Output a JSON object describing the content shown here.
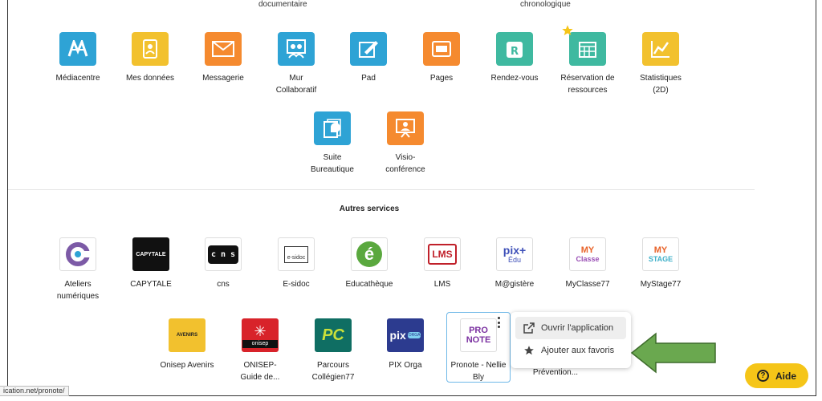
{
  "top_fragments": [
    "documentaire",
    "chronologique"
  ],
  "apps_row1": [
    {
      "label": "Médiacentre",
      "color": "#2ea3d5",
      "icon": "mediacentre-icon"
    },
    {
      "label": "Mes données",
      "color": "#f2c12e",
      "icon": "my-data-icon"
    },
    {
      "label": "Messagerie",
      "color": "#f58a2f",
      "icon": "envelope-icon"
    },
    {
      "label": "Mur Collaboratif",
      "color": "#2ea3d5",
      "icon": "collaborative-wall-icon"
    },
    {
      "label": "Pad",
      "color": "#2ea3d5",
      "icon": "pad-icon"
    },
    {
      "label": "Pages",
      "color": "#f58a2f",
      "icon": "pages-icon"
    },
    {
      "label": "Rendez-vous",
      "color": "#3fb9a0",
      "icon": "appointment-icon"
    },
    {
      "label": "Réservation de ressources",
      "color": "#3fb9a0",
      "icon": "calendar-icon",
      "favorite": true
    },
    {
      "label": "Statistiques (2D)",
      "color": "#f2c12e",
      "icon": "chart-icon"
    }
  ],
  "apps_row2": [
    {
      "label": "Suite Bureautique",
      "color": "#2ea3d5",
      "icon": "office-suite-icon"
    },
    {
      "label": "Visio-conférence",
      "color": "#f58a2f",
      "icon": "videoconference-icon"
    }
  ],
  "section_title": "Autres services",
  "services_row1": [
    {
      "label": "Ateliers numériques",
      "logo": "ateliers-numeriques-logo"
    },
    {
      "label": "CAPYTALE",
      "logo": "capytale-logo",
      "text": "CAPYTALE"
    },
    {
      "label": "cns",
      "logo": "cns-logo",
      "text": "c n s"
    },
    {
      "label": "E-sidoc",
      "logo": "esidoc-logo",
      "text": "e-sidoc"
    },
    {
      "label": "Educathèque",
      "logo": "educatheque-logo",
      "text": "é"
    },
    {
      "label": "LMS",
      "logo": "lms-logo",
      "text": "LMS"
    },
    {
      "label": "M@gistère",
      "logo": "pix-edu-logo",
      "text": "pix+",
      "subtext": "Édu"
    },
    {
      "label": "MyClasse77",
      "logo": "myclasse-logo",
      "text": "MY",
      "subtext": "Classe"
    },
    {
      "label": "MyStage77",
      "logo": "mystage-logo",
      "text": "MY",
      "subtext": "STAGE"
    }
  ],
  "services_row2": [
    {
      "label": "Onisep Avenirs",
      "logo": "onisep-avenirs-logo",
      "text": "AVENIRS"
    },
    {
      "label": "ONISEP- Guide de...",
      "logo": "onisep-logo",
      "text": "onisep"
    },
    {
      "label": "Parcours Collégien77",
      "logo": "parcours-logo",
      "text": "PC"
    },
    {
      "label": "PIX Orga",
      "logo": "pix-orga-logo",
      "text": "pix",
      "subtext": "ORGA"
    },
    {
      "label": "Pronote - Nellie Bly",
      "logo": "pronote-logo",
      "text": "PRO",
      "subtext": "NOTE"
    },
    {
      "label": "Prévention...",
      "logo": "",
      "text": ""
    }
  ],
  "context_menu": {
    "open_label": "Ouvrir l'application",
    "favorite_label": "Ajouter aux favoris"
  },
  "status_url": "ication.net/pronote/",
  "help_button": {
    "label": "Aide"
  },
  "arrow_color": "#6aa84f"
}
